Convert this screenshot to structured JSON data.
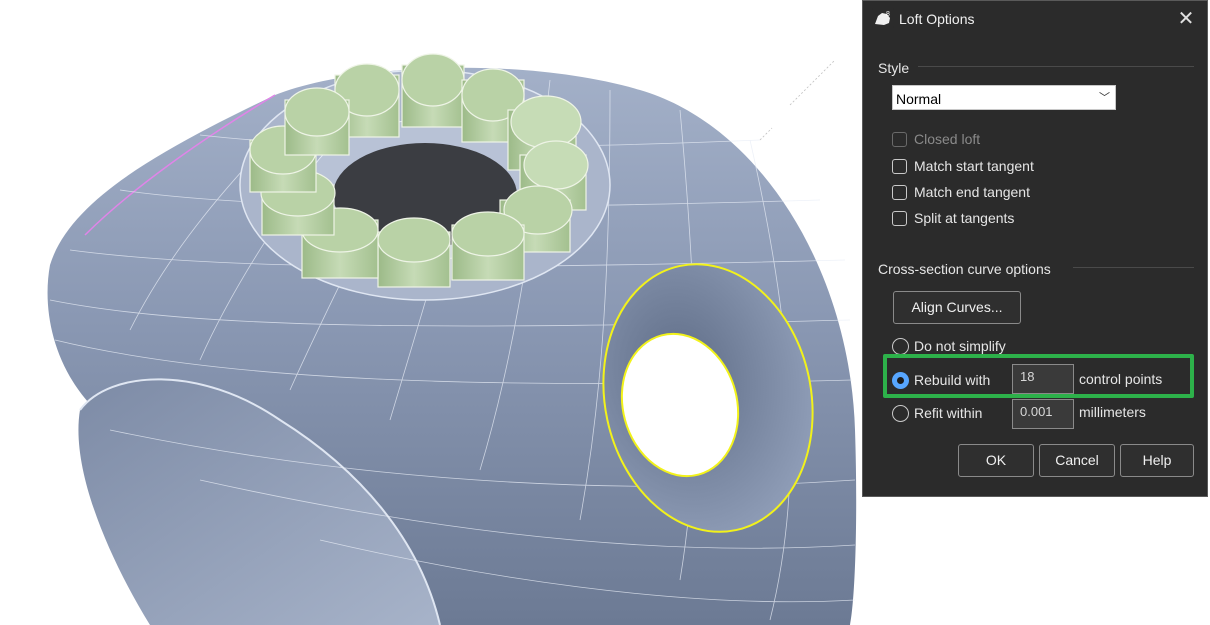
{
  "dialog": {
    "title": "Loft Options",
    "close_glyph": "✕",
    "app_icon": "rhino-8-icon",
    "style_section": "Style",
    "style_value": "Normal",
    "checkboxes": [
      {
        "label": "Closed loft",
        "checked": false,
        "enabled": false
      },
      {
        "label": "Match start tangent",
        "checked": false,
        "enabled": true
      },
      {
        "label": "Match end tangent",
        "checked": false,
        "enabled": true
      },
      {
        "label": "Split at tangents",
        "checked": false,
        "enabled": true
      }
    ],
    "cross_section_label": "Cross-section curve options",
    "align_curves_label": "Align Curves...",
    "radio_do_not_simplify": "Do not simplify",
    "radio_rebuild": "Rebuild with",
    "rebuild_value": "18",
    "rebuild_unit": "control points",
    "radio_refit": "Refit within",
    "refit_value": "0.001",
    "refit_unit": "millimeters",
    "selected_option": "Rebuild with",
    "ok_label": "OK",
    "cancel_label": "Cancel",
    "help_label": "Help"
  },
  "colors": {
    "dialog_bg": "#2b2b2b",
    "highlight": "#2db14a",
    "radio_accent": "#57a6ff",
    "ring_surface": "#8d9bb5",
    "gem_green": "#b4cfa3",
    "selection_yellow": "#f2f21a"
  }
}
